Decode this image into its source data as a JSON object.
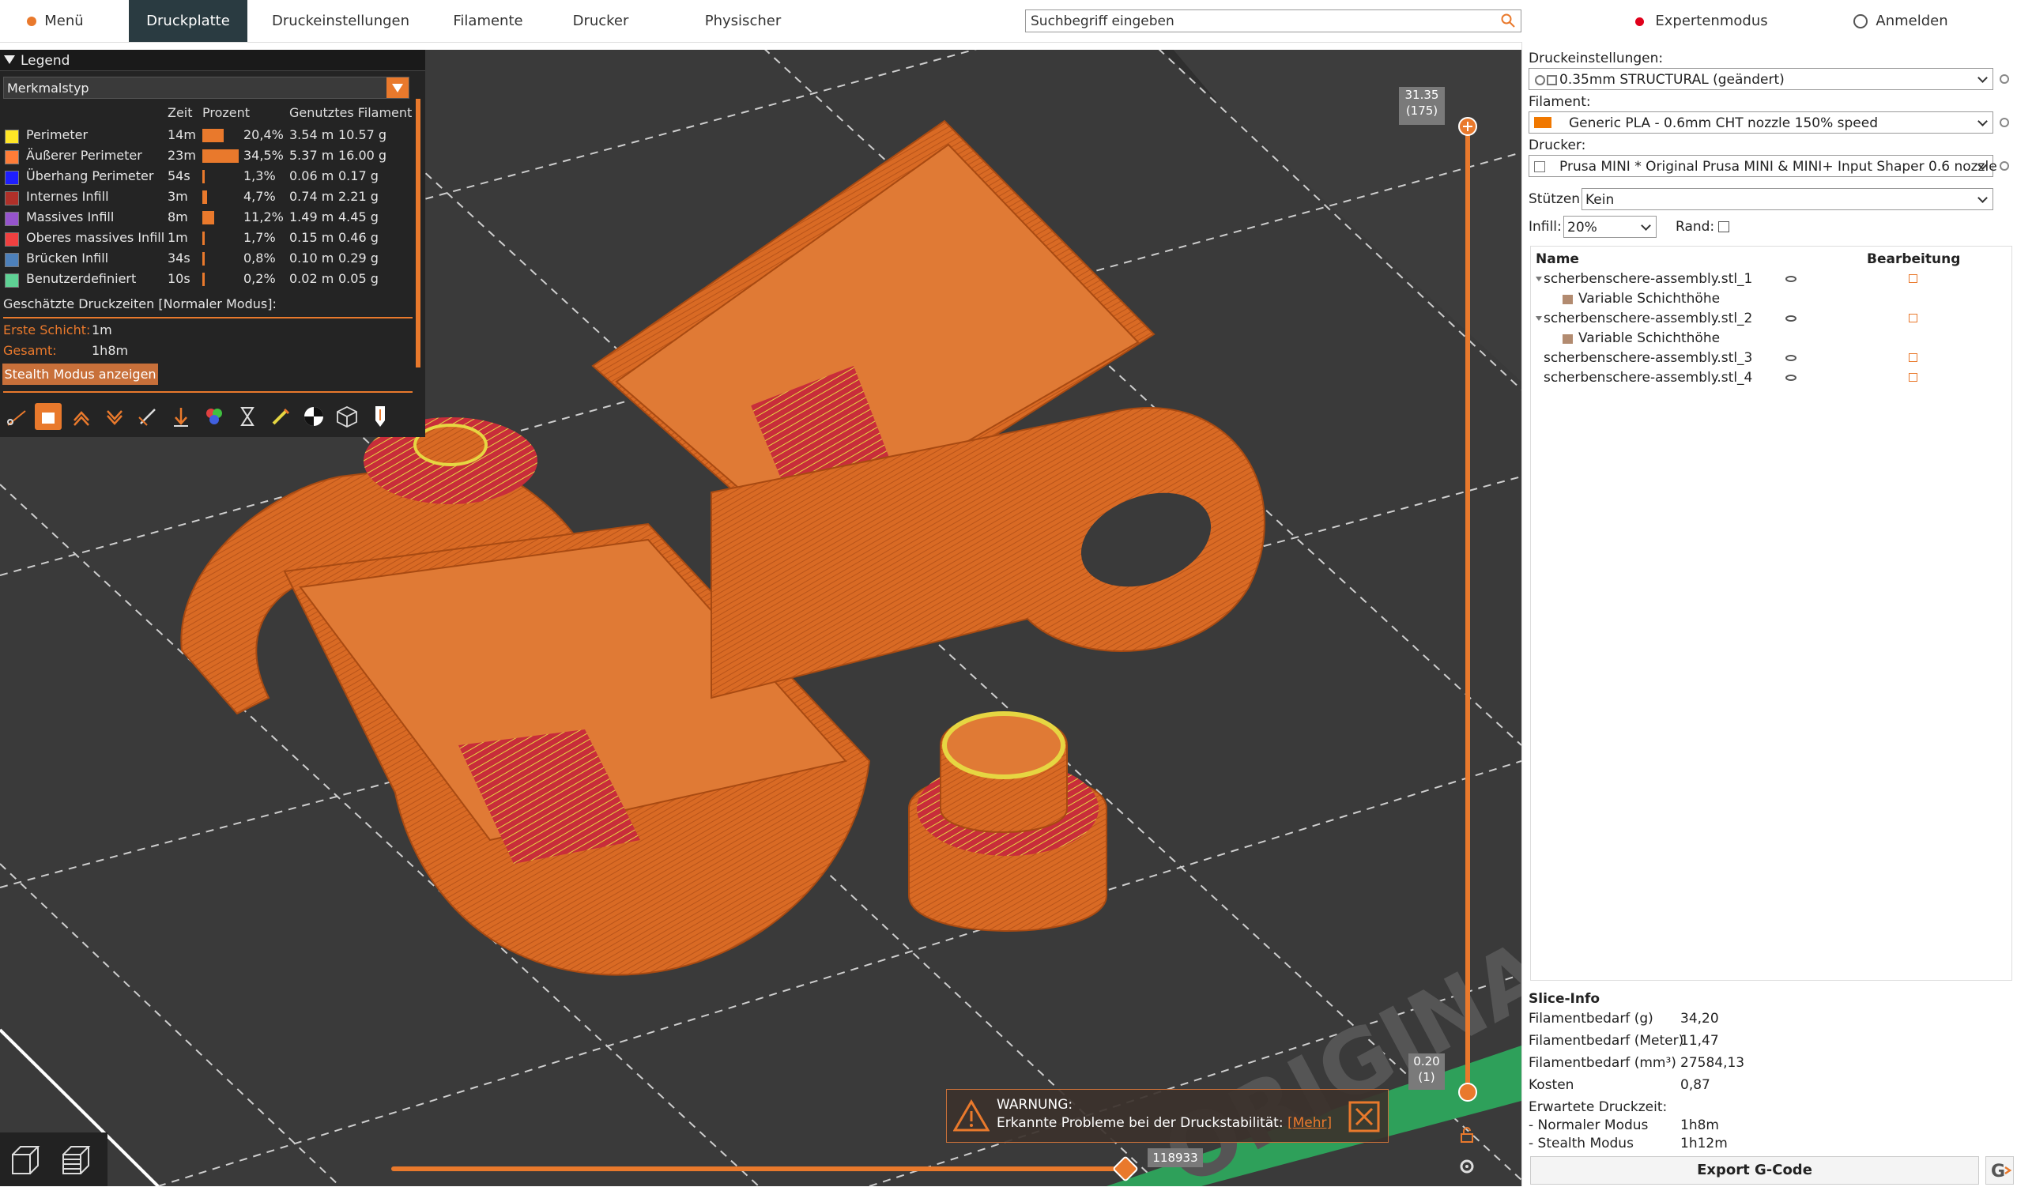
{
  "topbar": {
    "menu": "Menü",
    "tabs": [
      "Druckplatte",
      "Druckeinstellungen",
      "Filamente",
      "Drucker",
      "Physischer Drucker"
    ],
    "search_placeholder": "Suchbegriff eingeben",
    "mode": "Expertenmodus",
    "login": "Anmelden"
  },
  "legend": {
    "title": "Legend",
    "view_type": "Merkmalstyp",
    "columns": [
      "Zeit",
      "Prozent",
      "Genutztes Filament"
    ],
    "rows": [
      {
        "name": "Perimeter",
        "time": "14m",
        "percent": "20,4%",
        "length": "3.54 m",
        "weight": "10.57 g",
        "color": "#ffe626",
        "fraction": 0.204
      },
      {
        "name": "Äußerer Perimeter",
        "time": "23m",
        "percent": "34,5%",
        "length": "5.37 m",
        "weight": "16.00 g",
        "color": "#ff7d38",
        "fraction": 0.345
      },
      {
        "name": "Überhang Perimeter",
        "time": "54s",
        "percent": "1,3%",
        "length": "0.06 m",
        "weight": "0.17 g",
        "color": "#1f1fff",
        "fraction": 0.013
      },
      {
        "name": "Internes Infill",
        "time": "3m",
        "percent": "4,7%",
        "length": "0.74 m",
        "weight": "2.21 g",
        "color": "#b03029",
        "fraction": 0.047
      },
      {
        "name": "Massives Infill",
        "time": "8m",
        "percent": "11,2%",
        "length": "1.49 m",
        "weight": "4.45 g",
        "color": "#9654cc",
        "fraction": 0.112
      },
      {
        "name": "Oberes massives Infill",
        "time": "1m",
        "percent": "1,7%",
        "length": "0.15 m",
        "weight": "0.46 g",
        "color": "#f04040",
        "fraction": 0.017
      },
      {
        "name": "Brücken Infill",
        "time": "34s",
        "percent": "0,8%",
        "length": "0.10 m",
        "weight": "0.29 g",
        "color": "#4d80ba",
        "fraction": 0.008
      },
      {
        "name": "Benutzerdefiniert",
        "time": "10s",
        "percent": "0,2%",
        "length": "0.02 m",
        "weight": "0.05 g",
        "color": "#5ed194",
        "fraction": 0.002
      }
    ],
    "estimated_title": "Geschätzte Druckzeiten [Normaler Modus]:",
    "first_layer_label": "Erste Schicht:",
    "first_layer_value": "1m",
    "total_label": "Gesamt:",
    "total_value": "1h8m",
    "stealth_button": "Stealth Modus anzeigen"
  },
  "slider": {
    "top_value": "31.35",
    "top_layer": "(175)",
    "bottom_value": "0.20",
    "bottom_layer": "(1)",
    "horizontal_value": "118933"
  },
  "warning": {
    "title": "WARNUNG:",
    "text": "Erkannte Probleme bei der Druckstabilität:",
    "link": "[Mehr]"
  },
  "bed_text": "ORIGINAL P",
  "right": {
    "print_settings_label": "Druckeinstellungen:",
    "print_settings_value": "0.35mm STRUCTURAL (geändert)",
    "filament_label": "Filament:",
    "filament_value": "Generic PLA - 0.6mm CHT nozzle 150% speed",
    "filament_color": "#f07800",
    "printer_label": "Drucker:",
    "printer_value": "Prusa MINI * Original Prusa MINI & MINI+ Input Shaper 0.6 nozzle",
    "supports_label": "Stützen:",
    "supports_value": "Kein",
    "infill_label": "Infill:",
    "infill_value": "20%",
    "brim_label": "Rand:",
    "objects_header_name": "Name",
    "objects_header_edit": "Bearbeitung",
    "objects": [
      {
        "name": "scherbenschere-assembly.stl_1",
        "child": "Variable Schichthöhe"
      },
      {
        "name": "scherbenschere-assembly.stl_2",
        "child": "Variable Schichthöhe"
      },
      {
        "name": "scherbenschere-assembly.stl_3"
      },
      {
        "name": "scherbenschere-assembly.stl_4"
      }
    ],
    "slice_info_title": "Slice-Info",
    "slice_info": [
      {
        "label": "Filamentbedarf (g)",
        "value": "34,20"
      },
      {
        "label": "Filamentbedarf (Meter)",
        "value": "11,47"
      },
      {
        "label": "Filamentbedarf (mm³)",
        "value": "27584,13"
      },
      {
        "label": "Kosten",
        "value": "0,87"
      },
      {
        "label": "Erwartete Druckzeit:",
        "value": ""
      },
      {
        "label": " - Normaler Modus",
        "value": "1h8m"
      },
      {
        "label": " - Stealth Modus",
        "value": "1h12m"
      }
    ],
    "export_button": "Export G-Code"
  }
}
